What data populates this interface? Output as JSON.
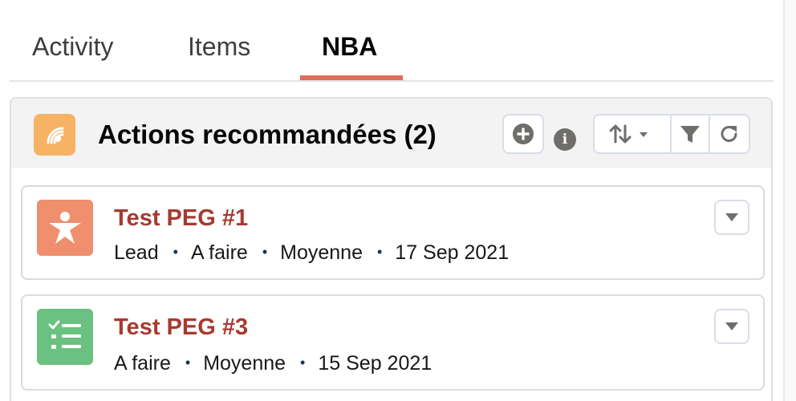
{
  "tabs": [
    {
      "label": "Activity",
      "active": false
    },
    {
      "label": "Items",
      "active": false
    },
    {
      "label": "NBA",
      "active": true
    }
  ],
  "panel": {
    "title": "Actions recommandées (2)",
    "icon": "recommendation-icon",
    "info_glyph": "i",
    "toolbar": [
      "add-icon",
      "info-icon",
      "sort-icon",
      "filter-icon",
      "refresh-icon"
    ]
  },
  "items": [
    {
      "title": "Test PEG #1",
      "icon": "person-icon",
      "icon_color": "#ef8f6d",
      "meta": [
        "Lead",
        "A faire",
        "Moyenne",
        "17 Sep 2021"
      ]
    },
    {
      "title": "Test PEG #3",
      "icon": "checklist-icon",
      "icon_color": "#6bc17f",
      "meta": [
        "A faire",
        "Moyenne",
        "15 Sep 2021"
      ]
    }
  ],
  "colors": {
    "accent_tab": "#e06c5a",
    "title_link": "#a63a2f",
    "header_icon_bg": "#f7b363"
  }
}
